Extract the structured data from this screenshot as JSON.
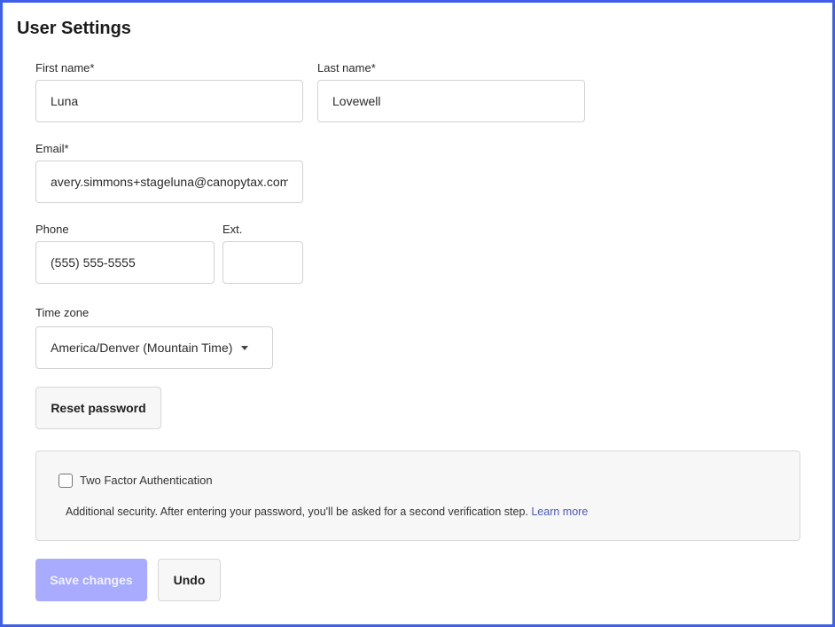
{
  "page": {
    "title": "User Settings"
  },
  "form": {
    "first_name": {
      "label": "First name*",
      "value": "Luna"
    },
    "last_name": {
      "label": "Last name*",
      "value": "Lovewell"
    },
    "email": {
      "label": "Email*",
      "value": "avery.simmons+stageluna@canopytax.com"
    },
    "phone": {
      "label": "Phone",
      "value": "(555) 555-5555"
    },
    "ext": {
      "label": "Ext.",
      "value": ""
    },
    "time_zone": {
      "label": "Time zone",
      "value": "America/Denver (Mountain Time)"
    }
  },
  "reset_password": {
    "label": "Reset password"
  },
  "two_factor": {
    "label": "Two Factor Authentication",
    "checked": false,
    "description": "Additional security. After entering your password, you'll be asked for a second verification step.",
    "learn_more": "Learn more"
  },
  "actions": {
    "save_label": "Save changes",
    "undo_label": "Undo"
  },
  "colors": {
    "frame_border": "#3e5fe6",
    "primary_disabled": "#a8abff",
    "link": "#4a5bb7"
  }
}
